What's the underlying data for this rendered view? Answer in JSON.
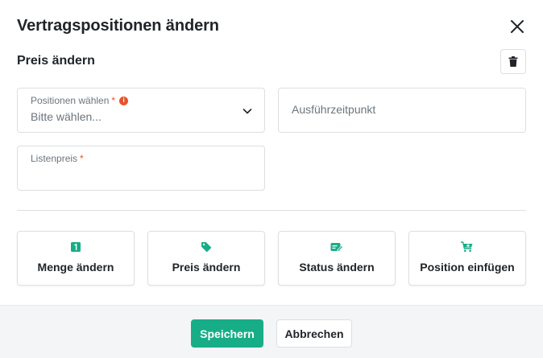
{
  "dialog": {
    "title": "Vertragspositionen ändern",
    "section_title": "Preis ändern"
  },
  "fields": {
    "positions": {
      "label": "Positionen wählen",
      "required_mark": "*",
      "value": "Bitte wählen..."
    },
    "execution_time": {
      "placeholder": "Ausführzeitpunkt"
    },
    "list_price": {
      "label": "Listenpreis",
      "required_mark": "*",
      "value": ""
    }
  },
  "actions": [
    {
      "label": "Menge ändern",
      "icon": "number-one-icon"
    },
    {
      "label": "Preis ändern",
      "icon": "price-tag-icon"
    },
    {
      "label": "Status ändern",
      "icon": "edit-status-icon"
    },
    {
      "label": "Position einfügen",
      "icon": "add-to-cart-icon"
    }
  ],
  "footer": {
    "save_label": "Speichern",
    "cancel_label": "Abbrechen"
  },
  "colors": {
    "accent": "#17ad87",
    "required": "#e5532d",
    "border": "#dcdfe3",
    "footer_bg": "#f4f5f7"
  }
}
